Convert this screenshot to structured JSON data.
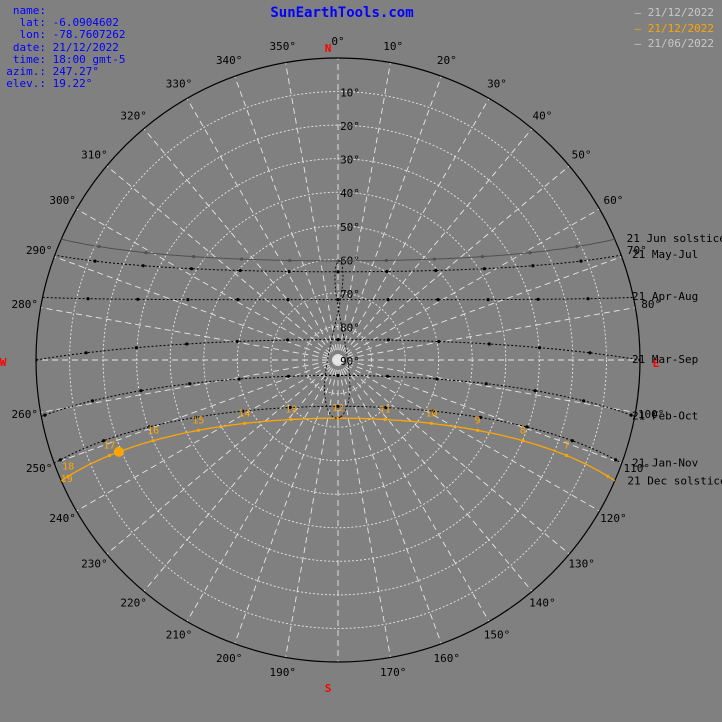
{
  "site": "SunEarthTools.com",
  "info": [
    {
      "key": "name:",
      "value": ""
    },
    {
      "key": "lat:",
      "value": "-6.0904602"
    },
    {
      "key": "lon:",
      "value": "-78.7607262"
    },
    {
      "key": "date:",
      "value": "21/12/2022"
    },
    {
      "key": "time:",
      "value": "18:00 gmt-5"
    },
    {
      "key": "azim.:",
      "value": "247.27°"
    },
    {
      "key": "elev.:",
      "value": "19.22°"
    }
  ],
  "legend": [
    {
      "label": "21/12/2022",
      "color": "#c8c8c8"
    },
    {
      "label": "21/12/2022",
      "color": "#ffa500"
    },
    {
      "label": "21/06/2022",
      "color": "#c8c8c8"
    }
  ],
  "chart_data": {
    "type": "polar sun path (azimuth / elevation)",
    "cardinals": {
      "north": "N",
      "south": "S",
      "east": "E",
      "west": "W"
    },
    "azimuth_ticks": [
      0,
      10,
      20,
      30,
      40,
      50,
      60,
      70,
      80,
      100,
      110,
      120,
      130,
      140,
      150,
      160,
      170,
      190,
      200,
      210,
      220,
      230,
      240,
      250,
      260,
      280,
      290,
      300,
      310,
      320,
      330,
      340,
      350
    ],
    "azimuth_tick_labels": [
      "0°",
      "10°",
      "20°",
      "30°",
      "40°",
      "50°",
      "60°",
      "70°",
      "80°",
      "100°",
      "110°",
      "120°",
      "130°",
      "140°",
      "150°",
      "160°",
      "170°",
      "190°",
      "200°",
      "210°",
      "220°",
      "230°",
      "240°",
      "250°",
      "260°",
      "280°",
      "290°",
      "300°",
      "310°",
      "320°",
      "330°",
      "340°",
      "350°"
    ],
    "elevation_ticks": [
      10,
      20,
      30,
      40,
      50,
      60,
      70,
      80,
      90
    ],
    "elevation_tick_labels": [
      "10°",
      "20°",
      "30°",
      "40°",
      "50°",
      "60°",
      "70°",
      "80°",
      "90°"
    ],
    "solstice_equinox_paths": [
      {
        "label": "21 Jun  solstice",
        "solar_declination": 23.44,
        "color": "#505050"
      },
      {
        "label": "21 May-Jul",
        "solar_declination": 20.2,
        "color": "#000000"
      },
      {
        "label": "21 Apr-Aug",
        "solar_declination": 11.9,
        "color": "#000000"
      },
      {
        "label": "21 Mar-Sep",
        "solar_declination": 0.0,
        "color": "#000000"
      },
      {
        "label": "21 Feb-Oct",
        "solar_declination": -10.7,
        "color": "#000000"
      },
      {
        "label": "21 Jan-Nov",
        "solar_declination": -19.9,
        "color": "#000000"
      },
      {
        "label": "21 Dec  solstice",
        "solar_declination": -23.44,
        "color": "#ffa500"
      }
    ],
    "hour_labels": [
      {
        "text": "7",
        "azimuth": 113.9,
        "elevation": 13.8
      },
      {
        "text": "8",
        "azimuth": 116.4,
        "elevation": 27.5
      },
      {
        "text": "9",
        "azimuth": 121.4,
        "elevation": 40.8
      },
      {
        "text": "10",
        "azimuth": 131.1,
        "elevation": 53.1
      },
      {
        "text": "11",
        "azimuth": 150.0,
        "elevation": 62.9
      },
      {
        "text": "12",
        "azimuth": 178.7,
        "elevation": 66.3
      },
      {
        "text": "13",
        "azimuth": 207.5,
        "elevation": 62.3
      },
      {
        "text": "14",
        "azimuth": 225.8,
        "elevation": 52.4
      },
      {
        "text": "15",
        "azimuth": 235.2,
        "elevation": 39.9
      },
      {
        "text": "16",
        "azimuth": 240.1,
        "elevation": 26.6
      },
      {
        "text": "17",
        "azimuth": 242.5,
        "elevation": 12.9
      },
      {
        "text": "18",
        "azimuth": 247.3,
        "elevation": 19.2
      },
      {
        "text": "19",
        "azimuth": 244.4,
        "elevation": -14.5
      }
    ],
    "current_sun_position": {
      "azimuth": 247.27,
      "elevation": 19.22
    },
    "analemma": true
  }
}
